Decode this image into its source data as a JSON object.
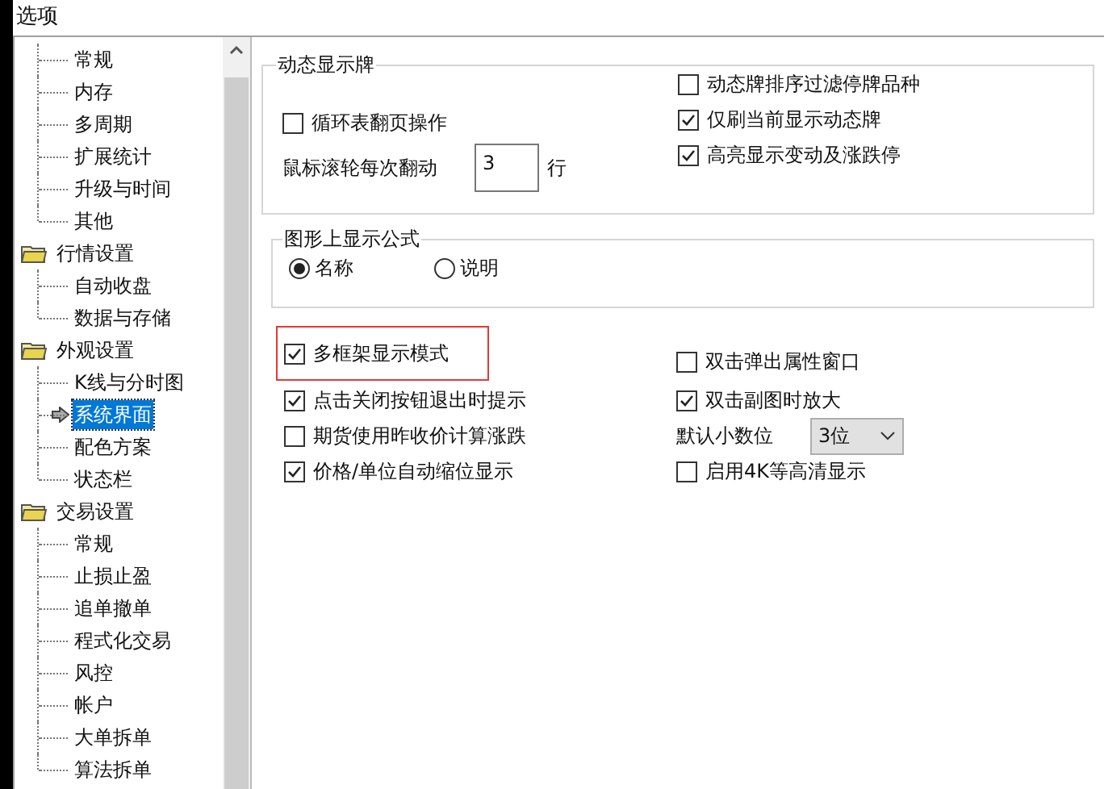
{
  "window": {
    "title": "选项"
  },
  "tree": [
    {
      "children": [
        {
          "label": "常规",
          "selected": false
        },
        {
          "label": "内存",
          "selected": false
        },
        {
          "label": "多周期",
          "selected": false
        },
        {
          "label": "扩展统计",
          "selected": false
        },
        {
          "label": "升级与时间",
          "selected": false
        },
        {
          "label": "其他",
          "selected": false
        }
      ]
    },
    {
      "label": "行情设置",
      "children": [
        {
          "label": "自动收盘",
          "selected": false
        },
        {
          "label": "数据与存储",
          "selected": false
        }
      ]
    },
    {
      "label": "外观设置",
      "children": [
        {
          "label": "K线与分时图",
          "selected": false
        },
        {
          "label": "系统界面",
          "selected": true
        },
        {
          "label": "配色方案",
          "selected": false
        },
        {
          "label": "状态栏",
          "selected": false
        }
      ]
    },
    {
      "label": "交易设置",
      "children": [
        {
          "label": "常规",
          "selected": false
        },
        {
          "label": "止损止盈",
          "selected": false
        },
        {
          "label": "追单撤单",
          "selected": false
        },
        {
          "label": "程式化交易",
          "selected": false
        },
        {
          "label": "风控",
          "selected": false
        },
        {
          "label": "帐户",
          "selected": false
        },
        {
          "label": "大单拆单",
          "selected": false
        },
        {
          "label": "算法拆单",
          "selected": false
        }
      ]
    }
  ],
  "dynamic_board": {
    "title": "动态显示牌",
    "left": [
      {
        "kind": "checkbox",
        "label": "循环表翻页操作",
        "checked": false
      },
      {
        "kind": "number",
        "label": "鼠标滚轮每次翻动",
        "value": "3",
        "unit": "行"
      }
    ],
    "right": [
      {
        "label": "动态牌排序过滤停牌品种",
        "checked": false
      },
      {
        "label": "仅刷当前显示动态牌",
        "checked": true
      },
      {
        "label": "高亮显示变动及涨跌停",
        "checked": true
      }
    ]
  },
  "formula_display": {
    "title": "图形上显示公式",
    "options": [
      {
        "label": "名称",
        "selected": true
      },
      {
        "label": "说明",
        "selected": false
      }
    ]
  },
  "options": [
    {
      "kind": "checkbox",
      "label": "多框架显示模式",
      "checked": true,
      "highlighted": true
    },
    {
      "kind": "checkbox",
      "label": "双击弹出属性窗口",
      "checked": false,
      "highlighted": false
    },
    {
      "kind": "checkbox",
      "label": "点击关闭按钮退出时提示",
      "checked": true,
      "highlighted": false
    },
    {
      "kind": "checkbox",
      "label": "双击副图时放大",
      "checked": true,
      "highlighted": false
    },
    {
      "kind": "checkbox",
      "label": "期货使用昨收价计算涨跌",
      "checked": false,
      "highlighted": false
    },
    {
      "kind": "select",
      "label": "默认小数位",
      "value": "3位",
      "highlighted": false
    },
    {
      "kind": "checkbox",
      "label": "价格/单位自动缩位显示",
      "checked": true,
      "highlighted": false
    },
    {
      "kind": "checkbox",
      "label": "启用4K等高清显示",
      "checked": false,
      "highlighted": false
    }
  ]
}
